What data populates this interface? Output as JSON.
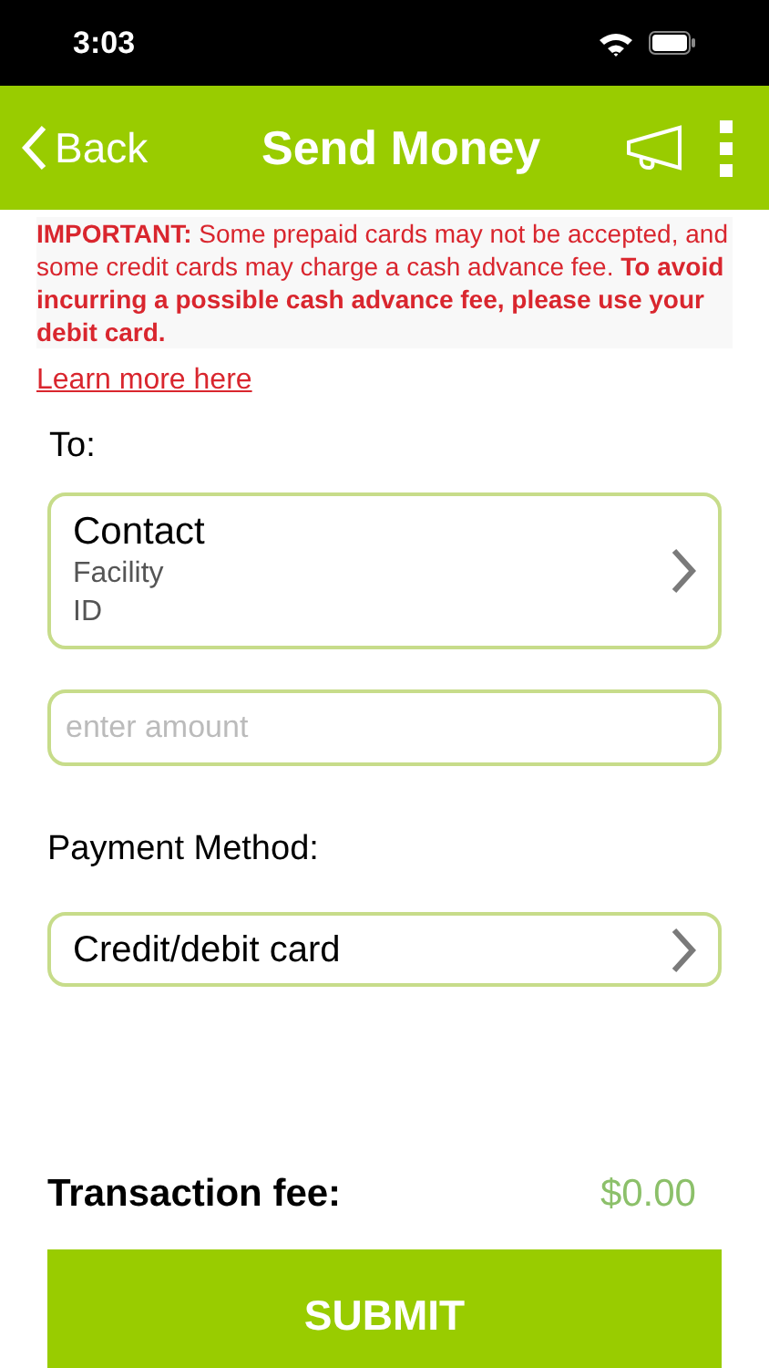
{
  "status_bar": {
    "time": "3:03"
  },
  "nav": {
    "back": "Back",
    "title": "Send Money"
  },
  "notice": {
    "text": "**IMPORTANT:** Some prepaid cards may not be accepted, and some credit cards may charge a cash advance fee.  **To avoid incurring a possible cash advance fee, please use your debit card.**",
    "link": "Learn more here"
  },
  "to": {
    "label": "To:",
    "name": "Contact",
    "lines": [
      "Facility",
      "ID"
    ]
  },
  "amount": {
    "placeholder": "enter amount"
  },
  "payment": {
    "label": "Payment Method:",
    "value": "Credit/debit card"
  },
  "fee": {
    "label": "Transaction fee:",
    "value": "$0.00"
  },
  "submit": "SUBMIT"
}
